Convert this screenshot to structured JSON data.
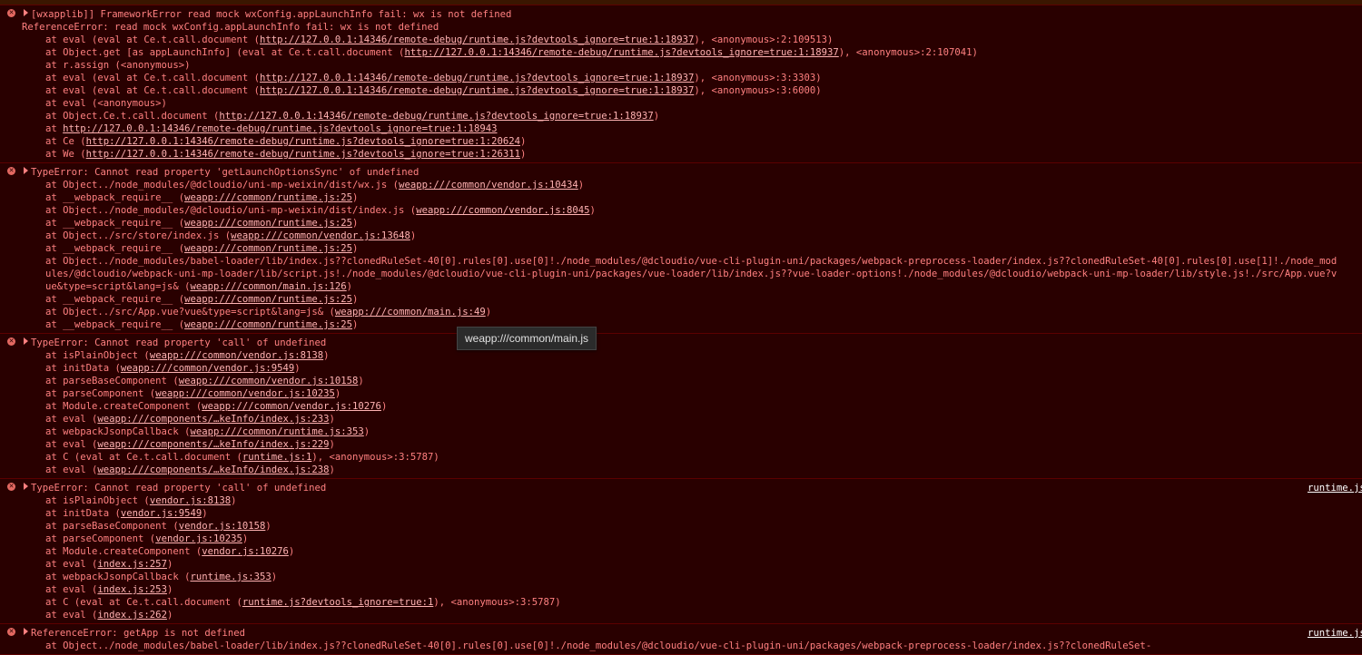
{
  "entries": [
    {
      "message": "[wxapplib]] FrameworkError read mock wxConfig.appLaunchInfo fail: wx is not defined",
      "source": "",
      "lines": [
        {
          "kind": "plain",
          "text": "ReferenceError: read mock wxConfig.appLaunchInfo fail: wx is not defined"
        },
        {
          "kind": "frame",
          "pre": "at eval (eval at Ce.t.call.document (",
          "link": "http://127.0.0.1:14346/remote-debug/runtime.js?devtools_ignore=true:1:18937",
          "post": "), <anonymous>:2:109513)"
        },
        {
          "kind": "frame",
          "pre": "at Object.get [as appLaunchInfo] (eval at Ce.t.call.document (",
          "link": "http://127.0.0.1:14346/remote-debug/runtime.js?devtools_ignore=true:1:18937",
          "post": "), <anonymous>:2:107041)"
        },
        {
          "kind": "frame",
          "pre": "at r.assign (<anonymous>)",
          "link": "",
          "post": ""
        },
        {
          "kind": "frame",
          "pre": "at eval (eval at Ce.t.call.document (",
          "link": "http://127.0.0.1:14346/remote-debug/runtime.js?devtools_ignore=true:1:18937",
          "post": "), <anonymous>:3:3303)"
        },
        {
          "kind": "frame",
          "pre": "at eval (eval at Ce.t.call.document (",
          "link": "http://127.0.0.1:14346/remote-debug/runtime.js?devtools_ignore=true:1:18937",
          "post": "), <anonymous>:3:6000)"
        },
        {
          "kind": "frame",
          "pre": "at eval (<anonymous>)",
          "link": "",
          "post": ""
        },
        {
          "kind": "frame",
          "pre": "at Object.Ce.t.call.document (",
          "link": "http://127.0.0.1:14346/remote-debug/runtime.js?devtools_ignore=true:1:18937",
          "post": ")"
        },
        {
          "kind": "frame",
          "pre": "at ",
          "link": "http://127.0.0.1:14346/remote-debug/runtime.js?devtools_ignore=true:1:18943",
          "post": ""
        },
        {
          "kind": "frame",
          "pre": "at Ce (",
          "link": "http://127.0.0.1:14346/remote-debug/runtime.js?devtools_ignore=true:1:20624",
          "post": ")"
        },
        {
          "kind": "frame",
          "pre": "at We (",
          "link": "http://127.0.0.1:14346/remote-debug/runtime.js?devtools_ignore=true:1:26311",
          "post": ")"
        }
      ]
    },
    {
      "message": "TypeError: Cannot read property 'getLaunchOptionsSync' of undefined",
      "source": "",
      "lines": [
        {
          "kind": "frame",
          "pre": "at Object../node_modules/@dcloudio/uni-mp-weixin/dist/wx.js (",
          "link": "weapp:///common/vendor.js:10434",
          "post": ")"
        },
        {
          "kind": "frame",
          "pre": "at __webpack_require__ (",
          "link": "weapp:///common/runtime.js:25",
          "post": ")"
        },
        {
          "kind": "frame",
          "pre": "at Object../node_modules/@dcloudio/uni-mp-weixin/dist/index.js (",
          "link": "weapp:///common/vendor.js:8045",
          "post": ")"
        },
        {
          "kind": "frame",
          "pre": "at __webpack_require__ (",
          "link": "weapp:///common/runtime.js:25",
          "post": ")"
        },
        {
          "kind": "frame",
          "pre": "at Object../src/store/index.js (",
          "link": "weapp:///common/vendor.js:13648",
          "post": ")"
        },
        {
          "kind": "frame",
          "pre": "at __webpack_require__ (",
          "link": "weapp:///common/runtime.js:25",
          "post": ")"
        },
        {
          "kind": "wrap",
          "pre": "at Object../node_modules/babel-loader/lib/index.js??clonedRuleSet-40[0].rules[0].use[0]!./node_modules/@dcloudio/vue-cli-plugin-uni/packages/webpack-preprocess-loader/index.js??clonedRuleSet-",
          "cont1": "40[0].rules[0].use[1]!./node_modules/@dcloudio/webpack-uni-mp-loader/lib/script.js!./node_modules/@dcloudio/vue-cli-plugin-uni/packages/vue-loader/lib/index.js??vue-loader-options!./node_modules/@dcloudio/webpack-uni-mp-",
          "cont2": "loader/lib/style.js!./src/App.vue?vue&type=script&lang=js& (",
          "link": "weapp:///common/main.js:126",
          "post": ")"
        },
        {
          "kind": "frame",
          "pre": "at __webpack_require__ (",
          "link": "weapp:///common/runtime.js:25",
          "post": ")"
        },
        {
          "kind": "frame",
          "pre": "at Object../src/App.vue?vue&type=script&lang=js& (",
          "link": "weapp:///common/main.js:49",
          "post": ")"
        },
        {
          "kind": "frame",
          "pre": "at __webpack_require__ (",
          "link": "weapp:///common/runtime.js:25",
          "post": ")"
        }
      ]
    },
    {
      "message": "TypeError: Cannot read property 'call' of undefined",
      "source": "",
      "lines": [
        {
          "kind": "frame",
          "pre": "at isPlainObject (",
          "link": "weapp:///common/vendor.js:8138",
          "post": ")"
        },
        {
          "kind": "frame",
          "pre": "at initData (",
          "link": "weapp:///common/vendor.js:9549",
          "post": ")"
        },
        {
          "kind": "frame",
          "pre": "at parseBaseComponent (",
          "link": "weapp:///common/vendor.js:10158",
          "post": ")"
        },
        {
          "kind": "frame",
          "pre": "at parseComponent (",
          "link": "weapp:///common/vendor.js:10235",
          "post": ")"
        },
        {
          "kind": "frame",
          "pre": "at Module.createComponent (",
          "link": "weapp:///common/vendor.js:10276",
          "post": ")"
        },
        {
          "kind": "frame",
          "pre": "at eval (",
          "link": "weapp:///components/…keInfo/index.js:233",
          "post": ")"
        },
        {
          "kind": "frame",
          "pre": "at webpackJsonpCallback (",
          "link": "weapp:///common/runtime.js:353",
          "post": ")"
        },
        {
          "kind": "frame",
          "pre": "at eval (",
          "link": "weapp:///components/…keInfo/index.js:229",
          "post": ")"
        },
        {
          "kind": "frame",
          "pre": "at C (eval at Ce.t.call.document (",
          "link": "runtime.js:1",
          "post": "), <anonymous>:3:5787)"
        },
        {
          "kind": "frame",
          "pre": "at eval (",
          "link": "weapp:///components/…keInfo/index.js:238",
          "post": ")"
        }
      ]
    },
    {
      "message": "TypeError: Cannot read property 'call' of undefined",
      "source": "runtime.js",
      "lines": [
        {
          "kind": "frame",
          "pre": "at isPlainObject (",
          "link": "vendor.js:8138",
          "post": ")"
        },
        {
          "kind": "frame",
          "pre": "at initData (",
          "link": "vendor.js:9549",
          "post": ")"
        },
        {
          "kind": "frame",
          "pre": "at parseBaseComponent (",
          "link": "vendor.js:10158",
          "post": ")"
        },
        {
          "kind": "frame",
          "pre": "at parseComponent (",
          "link": "vendor.js:10235",
          "post": ")"
        },
        {
          "kind": "frame",
          "pre": "at Module.createComponent (",
          "link": "vendor.js:10276",
          "post": ")"
        },
        {
          "kind": "frame",
          "pre": "at eval (",
          "link": "index.js:257",
          "post": ")"
        },
        {
          "kind": "frame",
          "pre": "at webpackJsonpCallback (",
          "link": "runtime.js:353",
          "post": ")"
        },
        {
          "kind": "frame",
          "pre": "at eval (",
          "link": "index.js:253",
          "post": ")"
        },
        {
          "kind": "frame",
          "pre": "at C (eval at Ce.t.call.document (",
          "link": "runtime.js?devtools_ignore=true:1",
          "post": "), <anonymous>:3:5787)"
        },
        {
          "kind": "frame",
          "pre": "at eval (",
          "link": "index.js:262",
          "post": ")"
        }
      ]
    },
    {
      "message": "ReferenceError: getApp is not defined",
      "source": "runtime.js",
      "lines": [
        {
          "kind": "frame",
          "pre": "at Object../node_modules/babel-loader/lib/index.js??clonedRuleSet-40[0].rules[0].use[0]!./node_modules/@dcloudio/vue-cli-plugin-uni/packages/webpack-preprocess-loader/index.js??clonedRuleSet-",
          "link": "",
          "post": ""
        }
      ]
    }
  ],
  "tooltip": "weapp:///common/main.js",
  "colors": {
    "background": "#290000",
    "text": "#ff8080",
    "separator": "#5c0000",
    "error_icon": "#e46962"
  }
}
